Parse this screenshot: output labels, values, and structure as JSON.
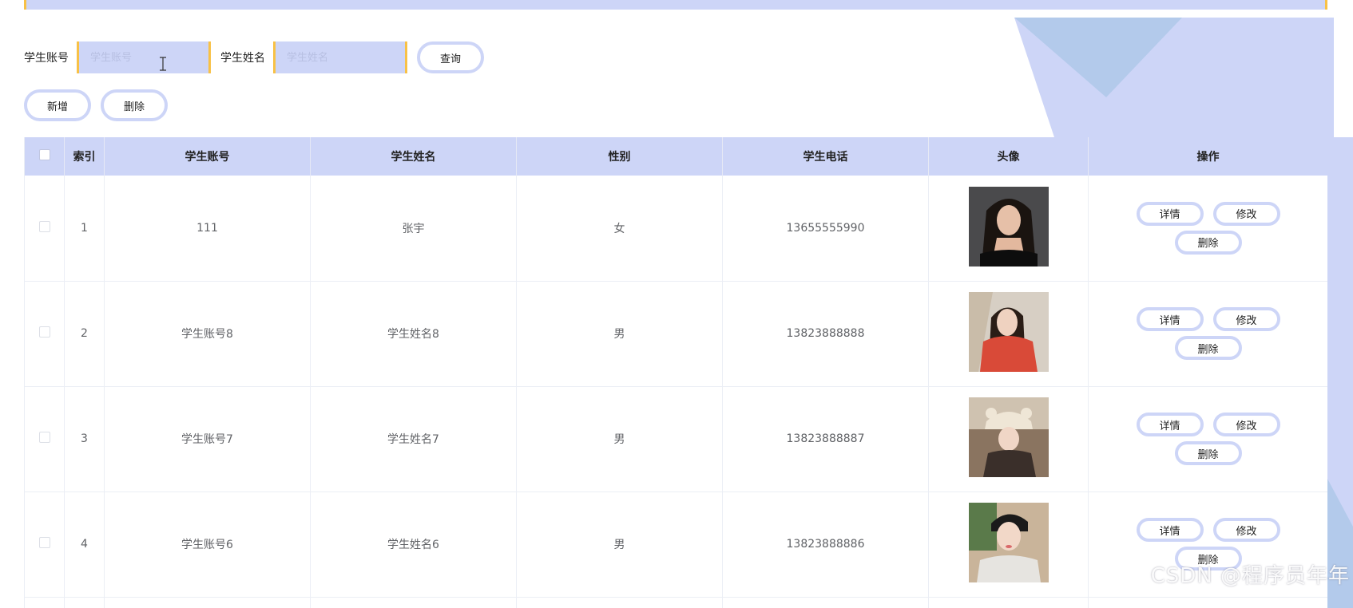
{
  "search": {
    "account_label": "学生账号",
    "account_placeholder": "学生账号",
    "name_label": "学生姓名",
    "name_placeholder": "学生姓名",
    "query_label": "查询"
  },
  "actions": {
    "add_label": "新增",
    "delete_label": "删除"
  },
  "table": {
    "headers": [
      "索引",
      "学生账号",
      "学生姓名",
      "性别",
      "学生电话",
      "头像",
      "操作"
    ],
    "rows": [
      {
        "index": "1",
        "account": "111",
        "name": "张宇",
        "gender": "女",
        "phone": "13655555990"
      },
      {
        "index": "2",
        "account": "学生账号8",
        "name": "学生姓名8",
        "gender": "男",
        "phone": "13823888888"
      },
      {
        "index": "3",
        "account": "学生账号7",
        "name": "学生姓名7",
        "gender": "男",
        "phone": "13823888887"
      },
      {
        "index": "4",
        "account": "学生账号6",
        "name": "学生姓名6",
        "gender": "男",
        "phone": "13823888886"
      }
    ],
    "row_actions": {
      "detail": "详情",
      "edit": "修改",
      "delete": "删除"
    }
  },
  "watermark": "CSDN @程序员年年",
  "colors": {
    "accent": "#cdd5f7",
    "border_accent": "#f8c146"
  }
}
